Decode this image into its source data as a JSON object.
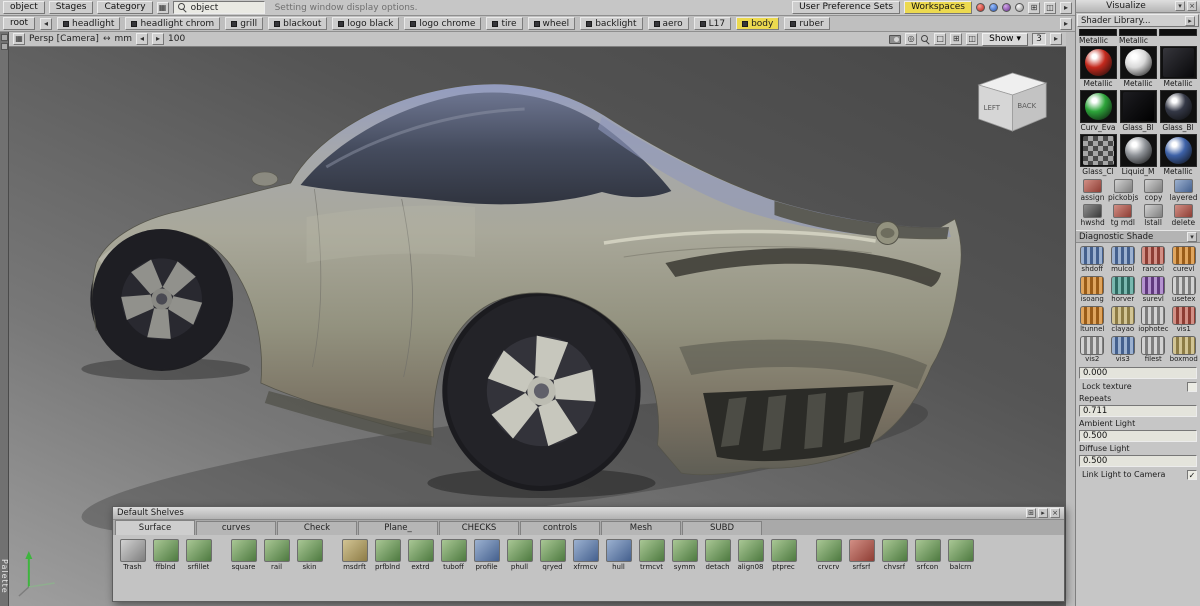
{
  "colors": {
    "accent_yellow": "#ecd94f",
    "panel_gray": "#c6c6c6",
    "viewport_dark": "#474747",
    "viewport_light": "#9f9f9f",
    "car_body": "#a8a79b",
    "car_roof_blue": "#8a93b8"
  },
  "menubar": {
    "corner_label": "object",
    "stages_label": "Stages",
    "category_label": "Category",
    "search_value": "object",
    "hint": "Setting window display options.",
    "user_pref_label": "User Preference Sets",
    "workspaces_label": "Workspaces"
  },
  "shelfbar": {
    "root_label": "root",
    "buttons": [
      {
        "label": "headlight",
        "state": ""
      },
      {
        "label": "headlight chrom",
        "state": ""
      },
      {
        "label": "grill",
        "state": ""
      },
      {
        "label": "blackout",
        "state": ""
      },
      {
        "label": "logo black",
        "state": ""
      },
      {
        "label": "logo chrome",
        "state": ""
      },
      {
        "label": "tire",
        "state": ""
      },
      {
        "label": "wheel",
        "state": ""
      },
      {
        "label": "backlight",
        "state": ""
      },
      {
        "label": "aero",
        "state": ""
      },
      {
        "label": "L17",
        "state": ""
      },
      {
        "label": "body",
        "state": "active"
      },
      {
        "label": "ruber",
        "state": ""
      }
    ]
  },
  "viewbar": {
    "camera_label": "Persp [Camera]",
    "units_label": "mm",
    "zoom_value": "100",
    "show_label": "Show",
    "page_value": "3"
  },
  "viewport": {
    "cube_left": "LEFT",
    "cube_back": "BACK"
  },
  "palette_label": "Palette",
  "visualize": {
    "title": "Visualize",
    "shader_library_label": "Shader Library...",
    "top_labels": [
      {
        "label": "Metallic"
      },
      {
        "label": "Metallic"
      }
    ],
    "swatches": [
      {
        "label": "Metallic",
        "kind": "red-sphere"
      },
      {
        "label": "Metallic",
        "kind": "silver-sphere"
      },
      {
        "label": "Metallic",
        "kind": "dark-panel"
      },
      {
        "label": "Curv_Eva",
        "kind": "green-sphere"
      },
      {
        "label": "Glass_Bl",
        "kind": "black-panel"
      },
      {
        "label": "Glass_Bl",
        "kind": "dark-sphere"
      },
      {
        "label": "Glass_Cl",
        "kind": "checker"
      },
      {
        "label": "Liquid_M",
        "kind": "chrome-sphere"
      },
      {
        "label": "Metallic",
        "kind": "blue-sphere"
      }
    ],
    "actions_row1": [
      {
        "label": "assign",
        "tint": "red"
      },
      {
        "label": "pickobjs",
        "tint": "gray"
      },
      {
        "label": "copy",
        "tint": "gray"
      },
      {
        "label": "layered",
        "tint": "blue"
      }
    ],
    "actions_row2": [
      {
        "label": "hwshd",
        "tint": "dark"
      },
      {
        "label": "tg mdl",
        "tint": "red"
      },
      {
        "label": "lstall",
        "tint": "gray"
      },
      {
        "label": "delete",
        "tint": "red"
      }
    ],
    "diagnostic_title": "Diagnostic Shade",
    "diag_tools": [
      {
        "label": "shdoff",
        "tint": "blue"
      },
      {
        "label": "mulcol",
        "tint": "blue"
      },
      {
        "label": "rancol",
        "tint": "red"
      },
      {
        "label": "curevl",
        "tint": "orange"
      },
      {
        "label": "isoang",
        "tint": "orange"
      },
      {
        "label": "horver",
        "tint": "teal"
      },
      {
        "label": "surevl",
        "tint": "purple"
      },
      {
        "label": "usetex",
        "tint": "gray"
      },
      {
        "label": "ltunnel",
        "tint": "orange"
      },
      {
        "label": "clayao",
        "tint": "tan"
      },
      {
        "label": "iophotec",
        "tint": "gray"
      },
      {
        "label": "vis1",
        "tint": "red"
      },
      {
        "label": "vis2",
        "tint": "gray"
      },
      {
        "label": "vis3",
        "tint": "blue"
      },
      {
        "label": "filest",
        "tint": "gray"
      },
      {
        "label": "boxmod",
        "tint": "tan"
      }
    ],
    "value_field": "0.000",
    "lock_texture_label": "Lock texture",
    "repeats_label": "Repeats",
    "repeats_value": "0.711",
    "ambient_label": "Ambient Light",
    "ambient_value": "0.500",
    "diffuse_label": "Diffuse Light",
    "diffuse_value": "0.500",
    "link_light_label": "Link Light to Camera",
    "link_light_checked": "✓"
  },
  "shelves": {
    "title": "Default Shelves",
    "tabs": [
      {
        "label": "Surface",
        "state": "active"
      },
      {
        "label": "curves",
        "state": ""
      },
      {
        "label": "Check",
        "state": ""
      },
      {
        "label": "Plane_",
        "state": ""
      },
      {
        "label": "CHECKS",
        "state": ""
      },
      {
        "label": "controls",
        "state": ""
      },
      {
        "label": "Mesh",
        "state": ""
      },
      {
        "label": "SUBD",
        "state": ""
      }
    ],
    "tools": [
      {
        "label": "Trash",
        "tint": "gray",
        "gap": ""
      },
      {
        "label": "ffblnd",
        "tint": "green",
        "gap": ""
      },
      {
        "label": "srfillet",
        "tint": "green",
        "gap": ""
      },
      {
        "label": "square",
        "tint": "green",
        "gap": "1"
      },
      {
        "label": "rail",
        "tint": "green",
        "gap": ""
      },
      {
        "label": "skin",
        "tint": "green",
        "gap": ""
      },
      {
        "label": "msdrft",
        "tint": "tan",
        "gap": "1"
      },
      {
        "label": "prfblnd",
        "tint": "green",
        "gap": ""
      },
      {
        "label": "extrd",
        "tint": "green",
        "gap": ""
      },
      {
        "label": "tuboff",
        "tint": "green",
        "gap": ""
      },
      {
        "label": "profile",
        "tint": "blue",
        "gap": ""
      },
      {
        "label": "phull",
        "tint": "green",
        "gap": ""
      },
      {
        "label": "qryed",
        "tint": "green",
        "gap": ""
      },
      {
        "label": "xfrmcv",
        "tint": "blue",
        "gap": ""
      },
      {
        "label": "hull",
        "tint": "blue",
        "gap": ""
      },
      {
        "label": "trmcvt",
        "tint": "green",
        "gap": ""
      },
      {
        "label": "symm",
        "tint": "green",
        "gap": ""
      },
      {
        "label": "detach",
        "tint": "green",
        "gap": ""
      },
      {
        "label": "align08",
        "tint": "green",
        "gap": ""
      },
      {
        "label": "ptprec",
        "tint": "green",
        "gap": ""
      },
      {
        "label": "crvcrv",
        "tint": "green",
        "gap": "1"
      },
      {
        "label": "srfsrf",
        "tint": "red",
        "gap": ""
      },
      {
        "label": "chvsrf",
        "tint": "green",
        "gap": ""
      },
      {
        "label": "srfcon",
        "tint": "green",
        "gap": ""
      },
      {
        "label": "balcrn",
        "tint": "green",
        "gap": ""
      }
    ]
  }
}
